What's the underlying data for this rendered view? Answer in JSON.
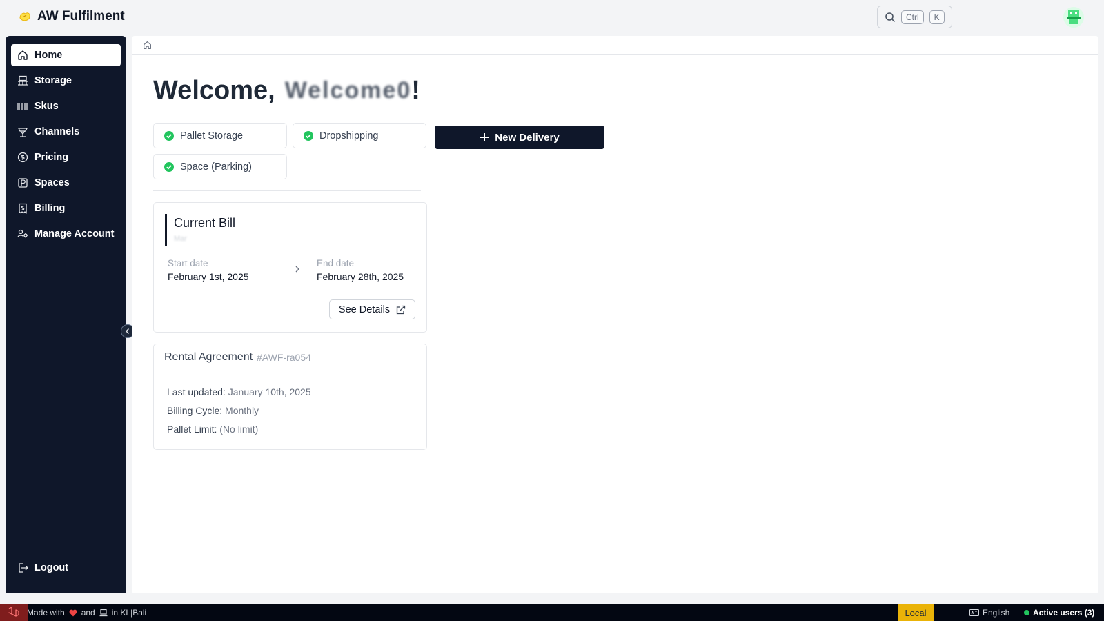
{
  "app": {
    "name": "AW Fulfilment"
  },
  "search": {
    "shortcut_ctrl": "Ctrl",
    "shortcut_key": "K"
  },
  "sidebar": {
    "items": [
      {
        "label": "Home",
        "icon": "home-icon",
        "active": true
      },
      {
        "label": "Storage",
        "icon": "storage-icon"
      },
      {
        "label": "Skus",
        "icon": "barcode-icon"
      },
      {
        "label": "Channels",
        "icon": "channels-icon"
      },
      {
        "label": "Pricing",
        "icon": "dollar-icon"
      },
      {
        "label": "Spaces",
        "icon": "parking-icon"
      },
      {
        "label": "Billing",
        "icon": "receipt-icon"
      },
      {
        "label": "Manage Account",
        "icon": "manage-account-icon"
      }
    ],
    "logout_label": "Logout"
  },
  "main": {
    "welcome_prefix": "Welcome,",
    "welcome_name": "Welcome0",
    "welcome_suffix": "!",
    "services": [
      {
        "label": "Pallet Storage"
      },
      {
        "label": "Dropshipping"
      },
      {
        "label": "Space (Parking)"
      }
    ],
    "new_delivery_label": "New Delivery",
    "current_bill": {
      "title": "Current Bill",
      "subtitle": "Mar",
      "start_label": "Start date",
      "start_value": "February 1st, 2025",
      "end_label": "End date",
      "end_value": "February 28th, 2025",
      "details_label": "See Details"
    },
    "rental": {
      "title": "Rental Agreement",
      "id": "#AWF-ra054",
      "last_updated_label": "Last updated:",
      "last_updated_value": "January 10th, 2025",
      "billing_cycle_label": "Billing Cycle:",
      "billing_cycle_value": "Monthly",
      "pallet_limit_label": "Pallet Limit:",
      "pallet_limit_value": "(No limit)"
    }
  },
  "statusbar": {
    "made_with": "Made with",
    "and": "and",
    "location": "in KL|Bali",
    "environment": "Local",
    "language": "English",
    "active_users": "Active users (3)"
  },
  "colors": {
    "sidebar_bg": "#0f172a",
    "accent_dark": "#0f172a",
    "check_green": "#22c55e",
    "env_badge": "#eab308"
  }
}
